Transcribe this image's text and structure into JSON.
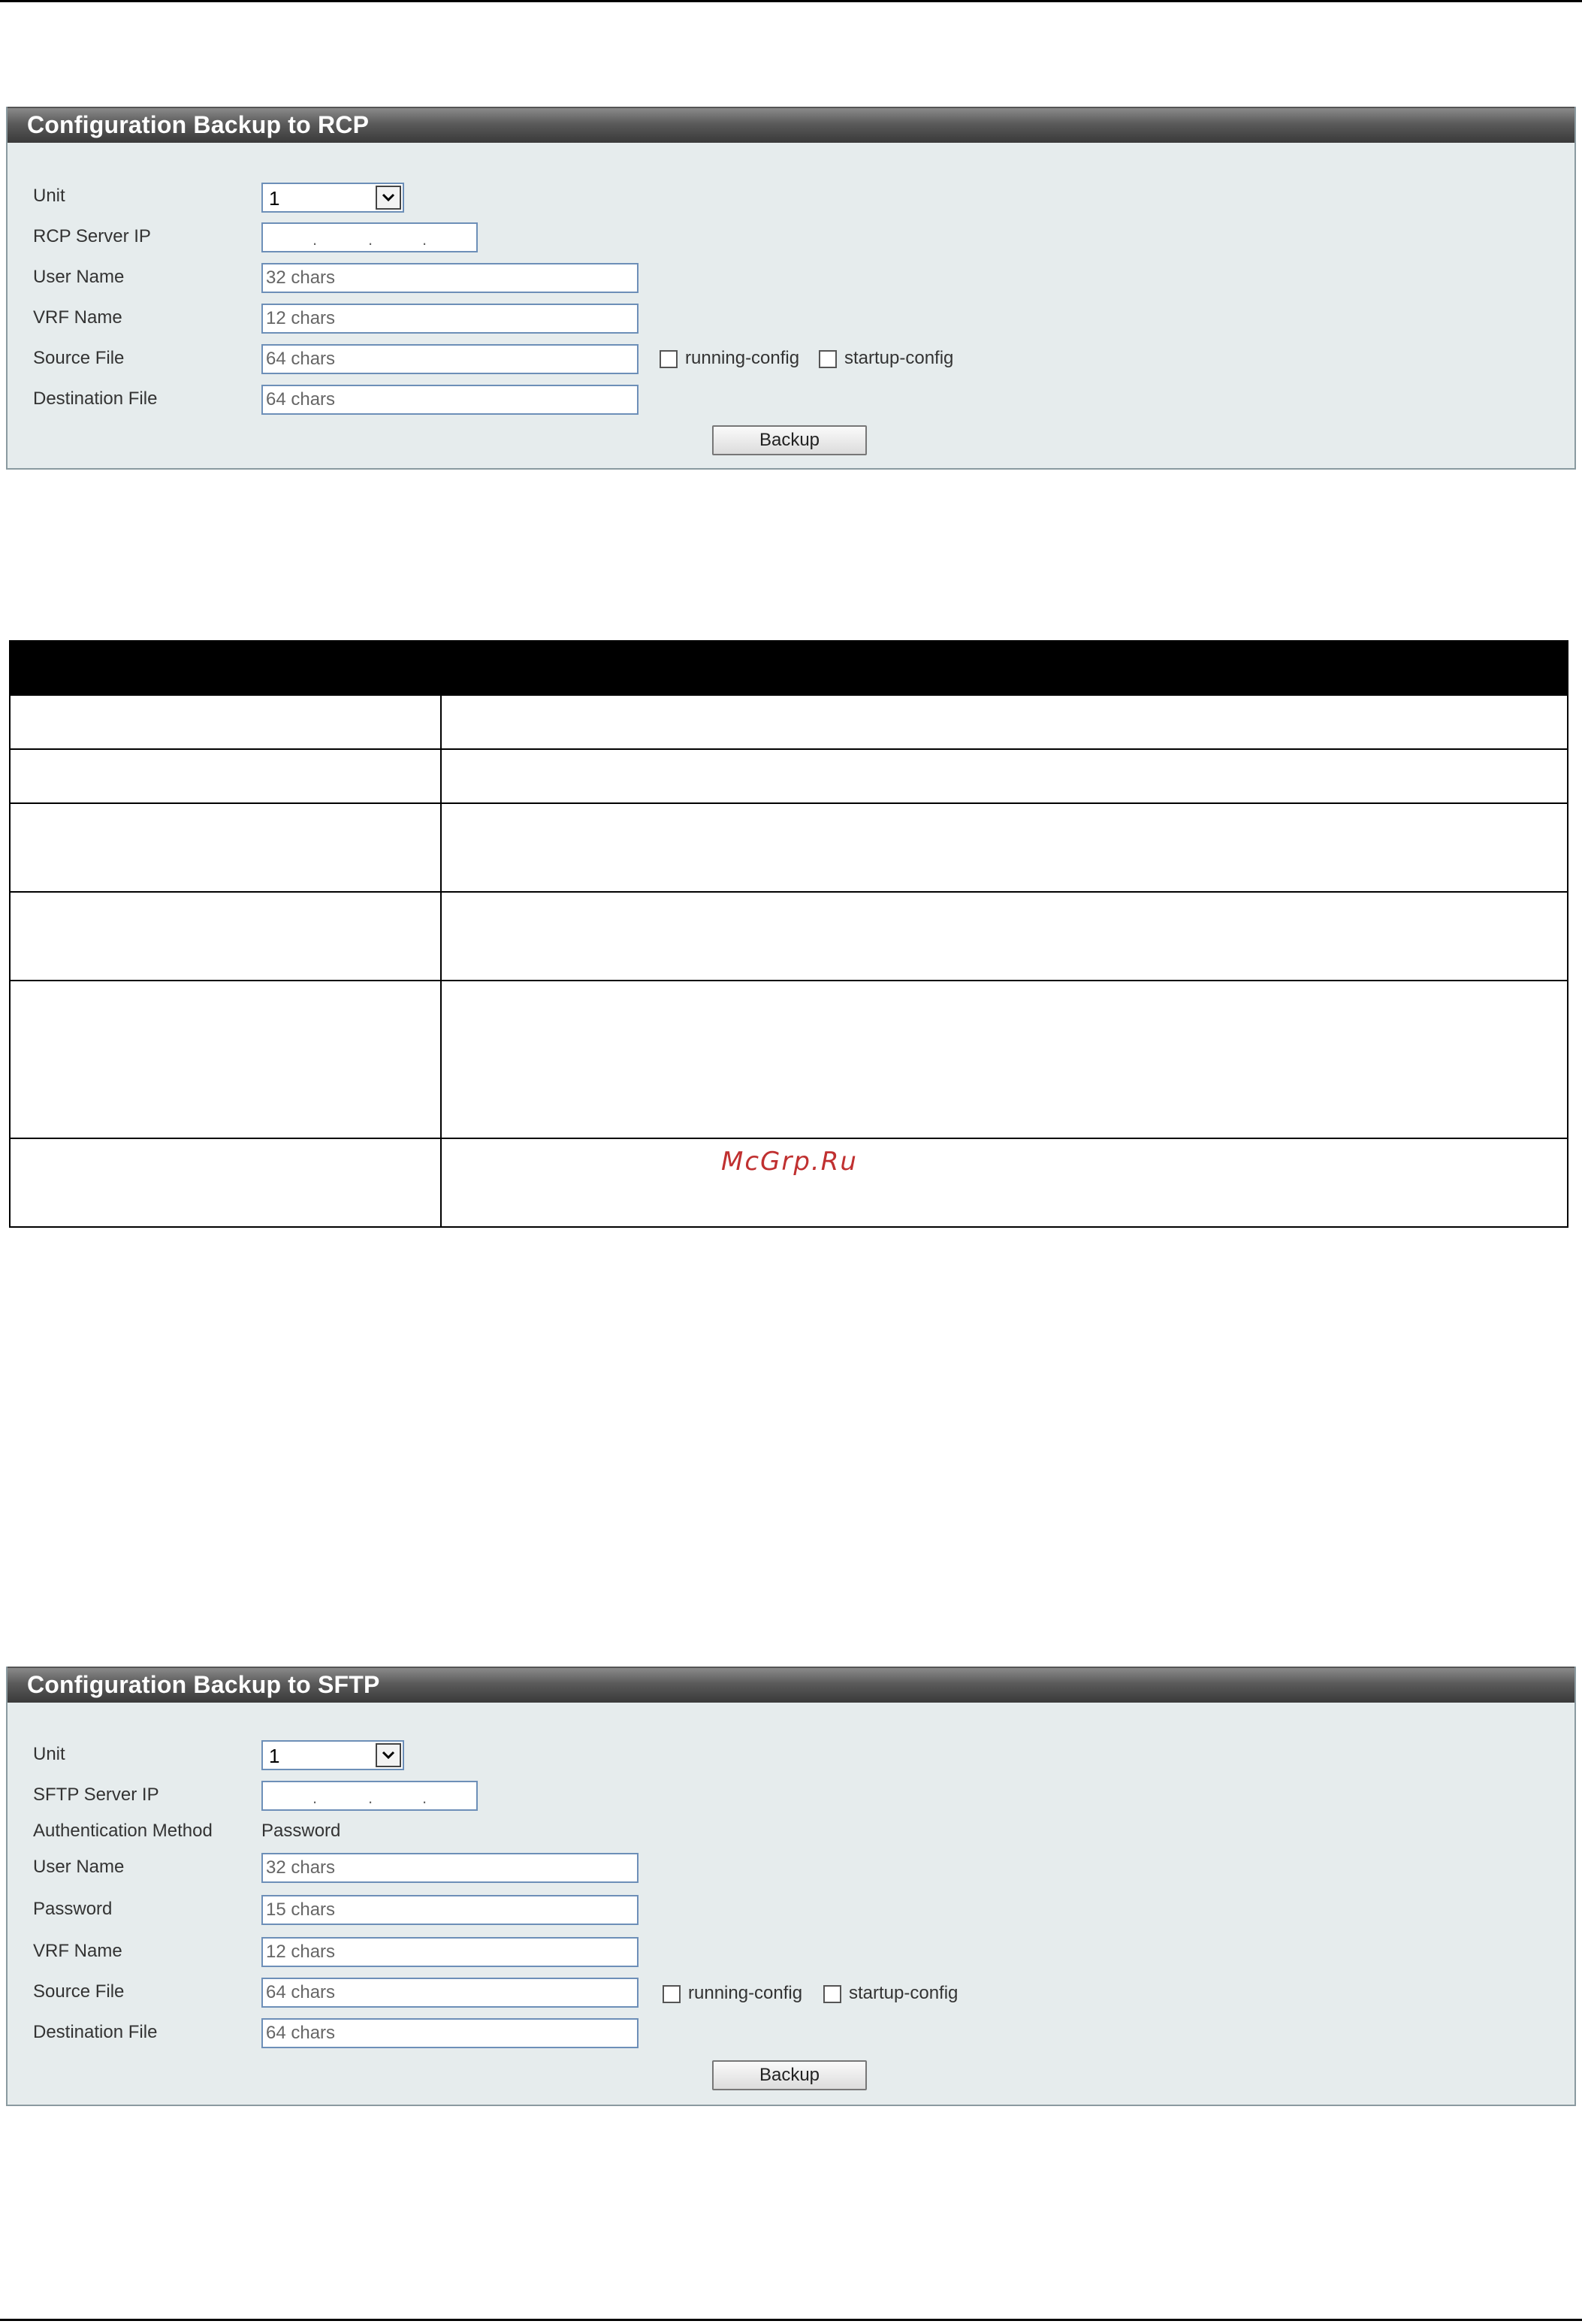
{
  "rcp": {
    "title": "Configuration Backup to RCP",
    "unit_label": "Unit",
    "unit_value": "1",
    "server_ip_label": "RCP Server IP",
    "user_name_label": "User Name",
    "user_name_placeholder": "32 chars",
    "vrf_label": "VRF Name",
    "vrf_placeholder": "12 chars",
    "source_label": "Source File",
    "source_placeholder": "64 chars",
    "running_config": "running-config",
    "startup_config": "startup-config",
    "dest_label": "Destination File",
    "dest_placeholder": "64 chars",
    "backup_button": "Backup"
  },
  "sftp": {
    "title": "Configuration Backup to SFTP",
    "unit_label": "Unit",
    "unit_value": "1",
    "server_ip_label": "SFTP Server IP",
    "auth_label": "Authentication Method",
    "auth_value": "Password",
    "user_name_label": "User Name",
    "user_name_placeholder": "32 chars",
    "password_label": "Password",
    "password_placeholder": "15 chars",
    "vrf_label": "VRF Name",
    "vrf_placeholder": "12 chars",
    "source_label": "Source File",
    "source_placeholder": "64 chars",
    "running_config": "running-config",
    "startup_config": "startup-config",
    "dest_label": "Destination File",
    "dest_placeholder": "64 chars",
    "backup_button": "Backup"
  },
  "watermark": "McGrp.Ru"
}
